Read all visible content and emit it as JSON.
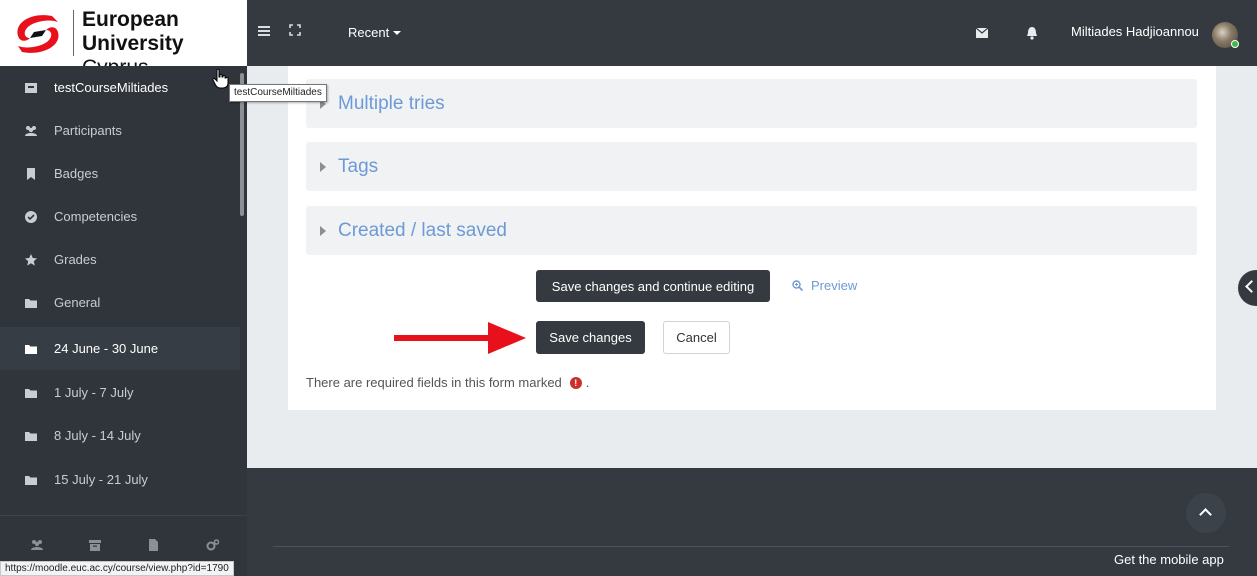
{
  "brand": {
    "line1": "European",
    "line2_bold": "University",
    "line2_rest": " Cyprus",
    "colors": {
      "navbar": "#343a40",
      "accent_red": "#e8111b",
      "link": "#6d9ad6"
    }
  },
  "navbar": {
    "recent_label": "Recent",
    "user_name": "Miltiades Hadjioannou",
    "icons": [
      "hamburger-icon",
      "expand-icon",
      "mail-icon",
      "bell-icon"
    ]
  },
  "sidebar": {
    "items": [
      {
        "label": "testCourseMiltiades",
        "icon": "course-icon"
      },
      {
        "label": "Participants",
        "icon": "users-icon"
      },
      {
        "label": "Badges",
        "icon": "bookmark-icon"
      },
      {
        "label": "Competencies",
        "icon": "check-circle-icon"
      },
      {
        "label": "Grades",
        "icon": "star-icon"
      },
      {
        "label": "General",
        "icon": "folder-icon"
      },
      {
        "label": "24 June - 30 June",
        "icon": "folder-icon"
      },
      {
        "label": "1 July - 7 July",
        "icon": "folder-icon"
      },
      {
        "label": "8 July - 14 July",
        "icon": "folder-icon"
      },
      {
        "label": "15 July - 21 July",
        "icon": "folder-icon"
      }
    ],
    "bottom_icons": [
      "users-icon",
      "archive-icon",
      "file-icon",
      "cogs-icon"
    ]
  },
  "tooltip": "testCourseMiltiades",
  "status_url": "https://moodle.euc.ac.cy/course/view.php?id=1790",
  "form": {
    "sections": [
      "Multiple tries",
      "Tags",
      "Created / last saved"
    ],
    "save_continue_label": "Save changes and continue editing",
    "preview_label": "Preview",
    "save_label": "Save changes",
    "cancel_label": "Cancel",
    "required_note": "There are required fields in this form marked",
    "required_note_end": " ."
  },
  "footer": {
    "mobile_app_label": "Get the mobile app"
  }
}
